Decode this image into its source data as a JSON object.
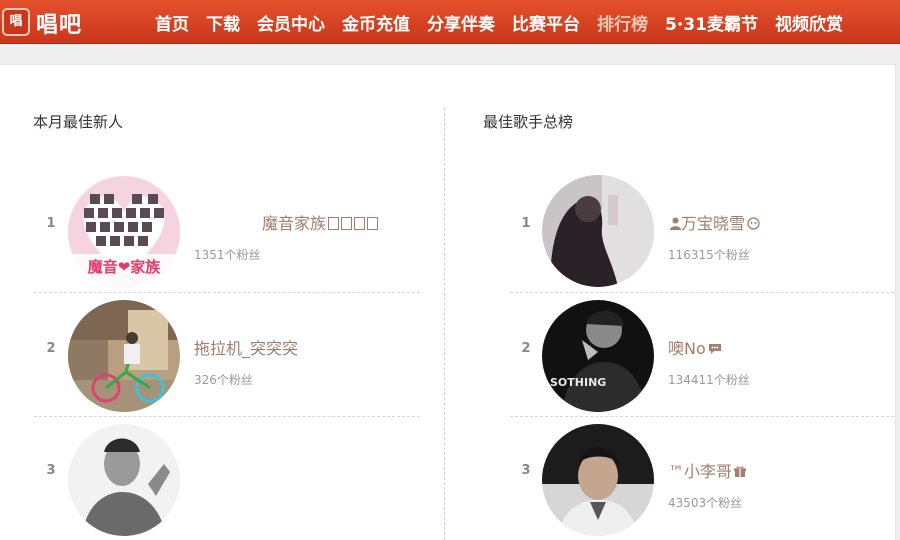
{
  "header": {
    "logo_badge": "唱",
    "logo_text": "唱吧",
    "nav": [
      {
        "label": "首页"
      },
      {
        "label": "下载"
      },
      {
        "label": "会员中心"
      },
      {
        "label": "金币充值"
      },
      {
        "label": "分享伴奏"
      },
      {
        "label": "比赛平台"
      },
      {
        "label": "排行榜"
      },
      {
        "label": "5·31麦霸节"
      },
      {
        "label": "视频欣赏"
      }
    ]
  },
  "colors": {
    "brand": "#d5401f",
    "name_text": "#a17e6e",
    "fans_text": "#9a9a9a"
  },
  "left_section": {
    "title": "本月最佳新人",
    "rows": [
      {
        "rank": "1",
        "name": "魔音家族",
        "fans": "1351个粉丝",
        "avatar_text": "魔音❤家族"
      },
      {
        "rank": "2",
        "name": "拖拉机_突突突",
        "fans": "326个粉丝"
      },
      {
        "rank": "3",
        "name": "",
        "fans": ""
      }
    ]
  },
  "right_section": {
    "title": "最佳歌手总榜",
    "rows": [
      {
        "rank": "1",
        "name": "万宝晓雪",
        "fans": "116315个粉丝",
        "prefix_icon": "person-icon",
        "suffix_icon": "badge-icon"
      },
      {
        "rank": "2",
        "name": "噢No",
        "fans": "134411个粉丝",
        "suffix_icon": "chat-bubble-icon",
        "avatar_text": "SOTHING"
      },
      {
        "rank": "3",
        "name": "™小李哥",
        "fans": "43503个粉丝",
        "suffix_icon": "gift-icon"
      }
    ]
  }
}
